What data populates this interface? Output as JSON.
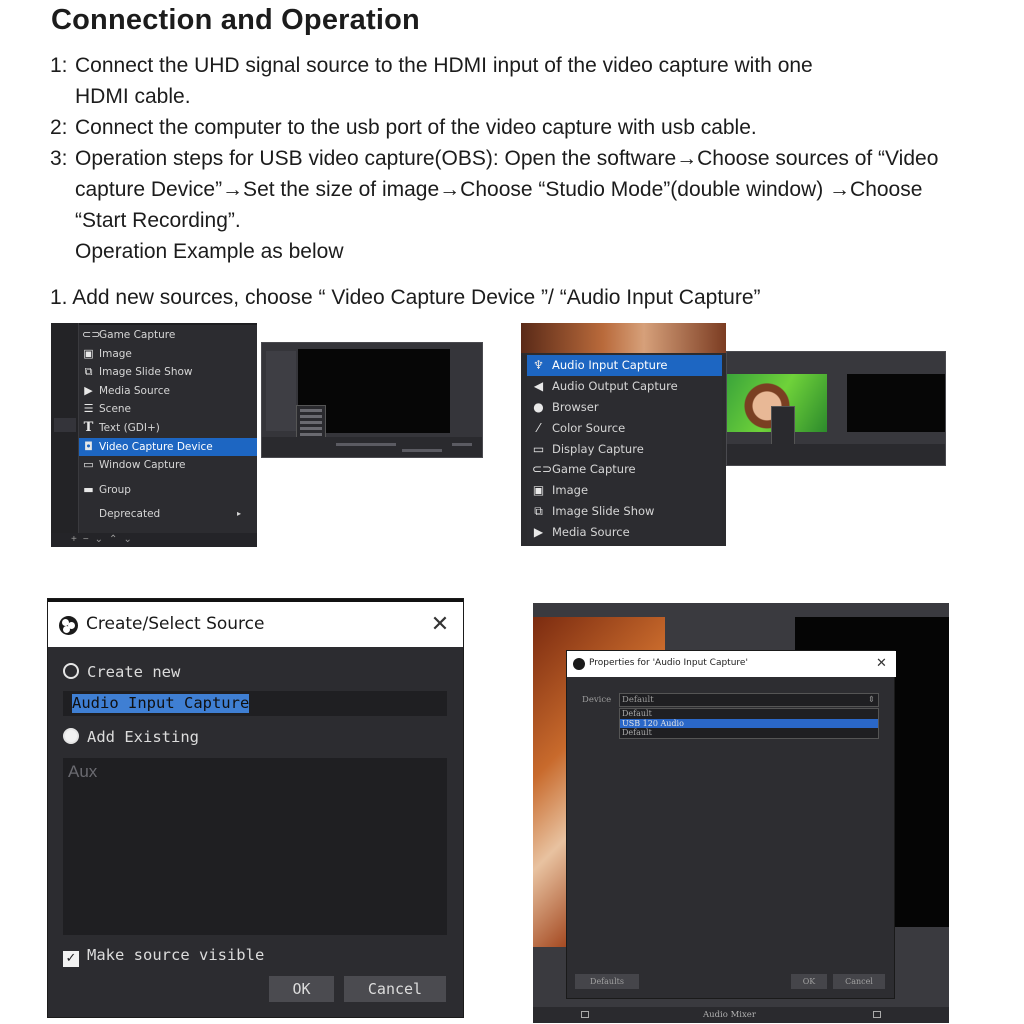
{
  "heading": "Connection and Operation",
  "steps": [
    {
      "num": "1:",
      "text": "Connect the UHD signal source to the HDMI input of the video capture with one HDMI cable."
    },
    {
      "num": "2:",
      "text": "Connect the computer to the usb port of the video capture with usb cable."
    },
    {
      "num": "3:",
      "text": "Operation steps for USB video capture(OBS): Open the software→Choose sources of “Video capture Device”→Set the size of image→Choose “Studio Mode”(double window) →Choose “Start Recording”."
    }
  ],
  "example_note": "Operation Example as below",
  "sub_step": "1. Add new sources, choose “ Video Capture Device ”/ “Audio Input Capture”",
  "menu1": {
    "items": [
      {
        "label": "Game Capture",
        "icon": "gamepad-icon"
      },
      {
        "label": "Image",
        "icon": "image-icon"
      },
      {
        "label": "Image Slide Show",
        "icon": "slideshow-icon"
      },
      {
        "label": "Media Source",
        "icon": "play-icon"
      },
      {
        "label": "Scene",
        "icon": "list-icon"
      },
      {
        "label": "Text (GDI+)",
        "icon": "text-icon"
      },
      {
        "label": "Video Capture Device",
        "icon": "camera-icon",
        "selected": true
      },
      {
        "label": "Window Capture",
        "icon": "window-icon"
      },
      {
        "label": "Group",
        "icon": "folder-icon"
      },
      {
        "label": "Deprecated",
        "icon": "",
        "submenu": true
      }
    ]
  },
  "menu2": {
    "items": [
      {
        "label": "Audio Input Capture",
        "icon": "microphone-icon",
        "selected": true
      },
      {
        "label": "Audio Output Capture",
        "icon": "speaker-icon"
      },
      {
        "label": "Browser",
        "icon": "globe-icon"
      },
      {
        "label": "Color Source",
        "icon": "brush-icon"
      },
      {
        "label": "Display Capture",
        "icon": "monitor-icon"
      },
      {
        "label": "Game Capture",
        "icon": "gamepad-icon"
      },
      {
        "label": "Image",
        "icon": "image-icon"
      },
      {
        "label": "Image Slide Show",
        "icon": "slideshow-icon"
      },
      {
        "label": "Media Source",
        "icon": "play-icon"
      }
    ]
  },
  "create_dialog": {
    "title": "Create/Select Source",
    "create_new_label": "Create new",
    "name_value": "Audio Input Capture",
    "add_existing_label": "Add Existing",
    "existing_items": [
      "Aux"
    ],
    "make_visible_label": "Make source visible",
    "ok_label": "OK",
    "cancel_label": "Cancel"
  },
  "properties_dialog": {
    "title": "Properties for 'Audio Input Capture'",
    "device_label": "Device",
    "device_value": "Default",
    "options": [
      "Default",
      "USB 120 Audio",
      "Default"
    ],
    "selected_index": 1,
    "defaults_label": "Defaults",
    "ok_label": "OK",
    "cancel_label": "Cancel",
    "footer_label": "Audio Mixer"
  },
  "colors": {
    "obs_dark": "#2b2b2e",
    "selection_blue": "#1d66c2",
    "text_dark": "#1c1c1c"
  }
}
